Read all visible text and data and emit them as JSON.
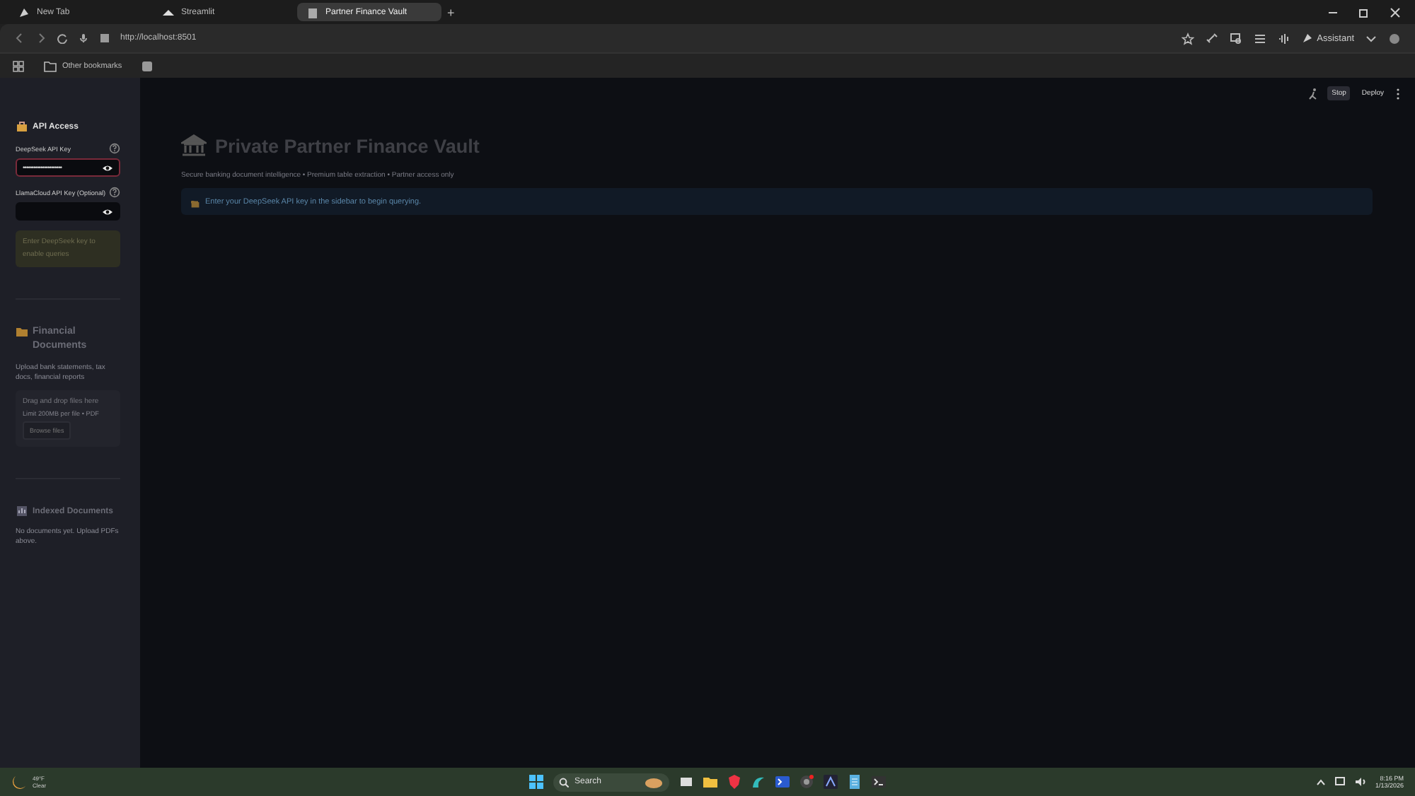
{
  "browser": {
    "tabs": [
      {
        "label": "New Tab",
        "selected": false
      },
      {
        "label": "Streamlit",
        "selected": false
      },
      {
        "label": "Partner Finance Vault",
        "selected": true
      }
    ],
    "new_tab_label": "+",
    "url": "http://localhost:8501",
    "assistant_label": "Assistant",
    "bookmarks": [
      "Other bookmarks"
    ]
  },
  "app": {
    "toolbar": {
      "stop_label": "Stop",
      "deploy_label": "Deploy"
    },
    "sidebar": {
      "api_section": {
        "title": "API Access",
        "fields": [
          {
            "label": "DeepSeek API Key",
            "value": "••••••••••••••••••••••",
            "focused": true
          },
          {
            "label": "LlamaCloud API Key (Optional)",
            "focused": false
          }
        ],
        "notice": "Enter DeepSeek key to enable queries"
      },
      "documents_section": {
        "title": "Financial Documents",
        "description": "Upload bank statements, tax docs, financial reports",
        "dropzone": {
          "title": "Drag and drop files here",
          "hint": "Limit 200MB per file • PDF",
          "button": "Browse files"
        }
      },
      "indexed_section": {
        "title": "Indexed Documents",
        "empty_text": "No documents yet. Upload PDFs above."
      }
    },
    "main": {
      "title": "Private Partner Finance Vault",
      "subtitle": "Secure banking document intelligence • Premium table extraction • Partner access only",
      "info": "Enter your DeepSeek API key in the sidebar to begin querying."
    }
  },
  "taskbar": {
    "weather": {
      "temperature": "49°F",
      "condition": "Clear"
    },
    "search_placeholder": "Search",
    "time": "8:16 PM",
    "date": "1/13/2026"
  }
}
